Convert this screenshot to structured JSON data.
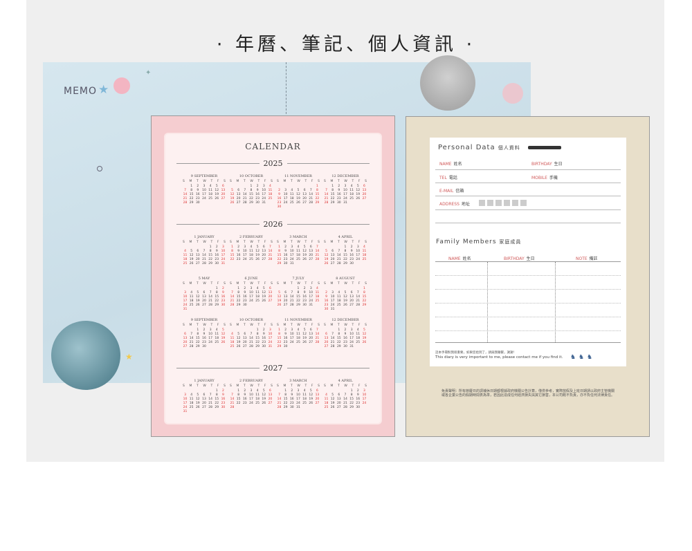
{
  "heading": "· 年曆、筆記、個人資訊 ·",
  "memo": {
    "label": "MEMO"
  },
  "calendar": {
    "title": "CALENDAR",
    "weekdays": [
      "S",
      "M",
      "T",
      "W",
      "T",
      "F",
      "S"
    ],
    "years": [
      "2025",
      "2026",
      "2027"
    ],
    "months": [
      {
        "name": "9 SEPTEMBER",
        "first": 1,
        "days": 30
      },
      {
        "name": "10 OCTOBER",
        "first": 3,
        "days": 31
      },
      {
        "name": "11 NOVEMBER",
        "first": 6,
        "days": 30
      },
      {
        "name": "12 DECEMBER",
        "first": 1,
        "days": 31
      },
      {
        "name": "1 JANUARY",
        "first": 4,
        "days": 31
      },
      {
        "name": "2 FEBRUARY",
        "first": 0,
        "days": 28
      },
      {
        "name": "3 MARCH",
        "first": 0,
        "days": 31
      },
      {
        "name": "4 APRIL",
        "first": 3,
        "days": 30
      },
      {
        "name": "5 MAY",
        "first": 5,
        "days": 31
      },
      {
        "name": "6 JUNE",
        "first": 1,
        "days": 30
      },
      {
        "name": "7 JULY",
        "first": 3,
        "days": 31
      },
      {
        "name": "8 AUGUST",
        "first": 6,
        "days": 31
      },
      {
        "name": "9 SEPTEMBER",
        "first": 2,
        "days": 30
      },
      {
        "name": "10 OCTOBER",
        "first": 4,
        "days": 31
      },
      {
        "name": "11 NOVEMBER",
        "first": 0,
        "days": 30
      },
      {
        "name": "12 DECEMBER",
        "first": 2,
        "days": 31
      },
      {
        "name": "1 JANUARY",
        "first": 5,
        "days": 31
      },
      {
        "name": "2 FEBRUARY",
        "first": 1,
        "days": 28
      },
      {
        "name": "3 MARCH",
        "first": 1,
        "days": 31
      },
      {
        "name": "4 APRIL",
        "first": 4,
        "days": 30
      }
    ]
  },
  "personal": {
    "title": "Personal Data",
    "title_zh": "個人資料",
    "name_label": "NAME",
    "name_zh": "姓名",
    "birthday_label": "BIRTHDAY",
    "birthday_zh": "生日",
    "tel_label": "TEL",
    "tel_zh": "電話",
    "mobile_label": "MOBILE",
    "mobile_zh": "手機",
    "email_label": "E-MAIL",
    "email_zh": "信箱",
    "address_label": "ADDRESS",
    "address_zh": "地址"
  },
  "family": {
    "title": "Family Members",
    "title_zh": "家庭成員",
    "col_name": "NAME",
    "col_name_zh": "姓名",
    "col_birthday": "BIRTHDAY",
    "col_birthday_zh": "生日",
    "col_note": "NOTE",
    "col_note_zh": "備註"
  },
  "lost": {
    "zh": "這本手冊對我很重要，如果您拾到了，請與我聯繫，謝謝！",
    "en": "This diary is very important to me, please contact me if you find it."
  },
  "disclaimer": "免責聲明：所有節慶日的調補休日期都根據政府機關公告計算，僅供參考，實際放假及上班日期請以政府主管機關或各企業公告的假期時間表為準，若因此造成任何經濟損失與其它損害，本公司概不負責，亦不負任何法律責任。"
}
